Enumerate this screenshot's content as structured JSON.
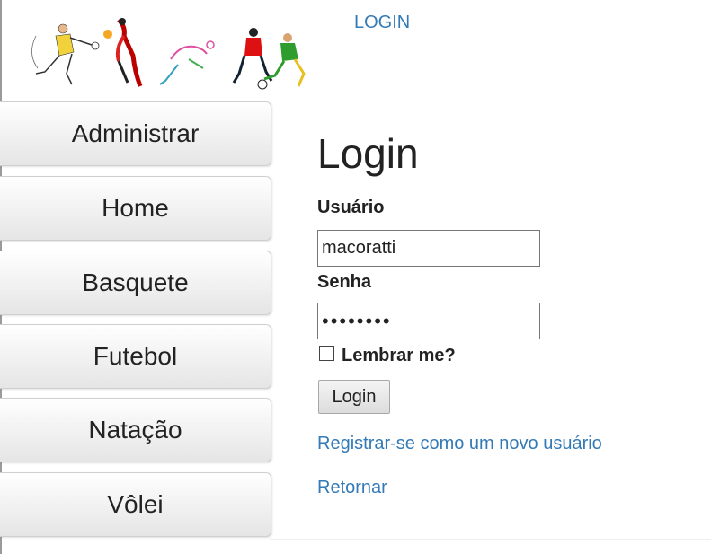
{
  "header": {
    "login_link": "LOGIN",
    "banner_name": "sports-players-banner"
  },
  "sidebar": {
    "items": [
      {
        "label": "Administrar"
      },
      {
        "label": "Home"
      },
      {
        "label": "Basquete"
      },
      {
        "label": "Futebol"
      },
      {
        "label": "Natação"
      },
      {
        "label": "Vôlei"
      }
    ]
  },
  "login": {
    "title": "Login",
    "username_label": "Usuário",
    "username_value": "macoratti",
    "password_label": "Senha",
    "password_value": "••••••••",
    "remember_label": "Lembrar me?",
    "remember_checked": false,
    "submit_label": "Login",
    "register_link": "Registrar-se como um novo usuário",
    "back_link": "Retornar"
  },
  "colors": {
    "link": "#337ab7",
    "menu_gradient_top": "#ffffff",
    "menu_gradient_bottom": "#e5e5e5"
  }
}
